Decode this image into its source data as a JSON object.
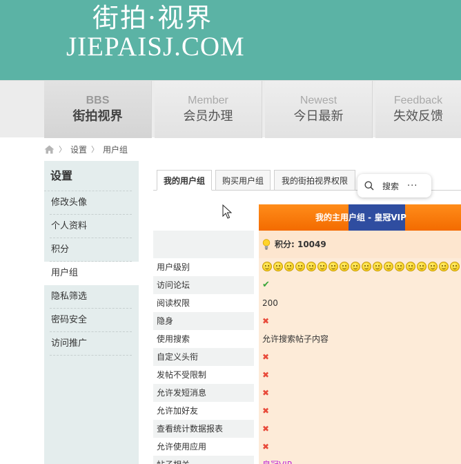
{
  "banner": {
    "logo_cn": "街拍·视界",
    "logo_en": "JIEPAISJ.COM"
  },
  "nav": [
    {
      "en": "BBS",
      "cn": "街拍视界"
    },
    {
      "en": "Member",
      "cn": "会员办理"
    },
    {
      "en": "Newest",
      "cn": "今日最新"
    },
    {
      "en": "Feedback",
      "cn": "失效反馈"
    }
  ],
  "breadcrumb": {
    "items": [
      "设置",
      "用户组"
    ]
  },
  "sidebar": {
    "title": "设置",
    "items": [
      "修改头像",
      "个人资料",
      "积分",
      "用户组",
      "隐私筛选",
      "密码安全",
      "访问推广"
    ]
  },
  "tabs": [
    "我的用户组",
    "购买用户组",
    "我的街拍视界权限"
  ],
  "search": {
    "label": "搜索",
    "more": "···"
  },
  "group": {
    "title": "我的主用户组 - 皇冠VIP",
    "points_label": "积分: 10049",
    "rows": [
      {
        "label": "用户级别",
        "value": ""
      },
      {
        "label": "访问论坛",
        "value": "✔"
      },
      {
        "label": "阅读权限",
        "value": "200"
      },
      {
        "label": "隐身",
        "value": "✖"
      },
      {
        "label": "使用搜索",
        "value": "允许搜索帖子内容"
      },
      {
        "label": "自定义头衔",
        "value": "✖"
      },
      {
        "label": "发帖不受限制",
        "value": "✖"
      },
      {
        "label": "允许发短消息",
        "value": "✖"
      },
      {
        "label": "允许加好友",
        "value": "✖"
      },
      {
        "label": "查看统计数据报表",
        "value": "✖"
      },
      {
        "label": "允许使用应用",
        "value": "✖"
      },
      {
        "label": "帖子相关",
        "value": "皇冠VIP"
      }
    ],
    "level_icon": "smiley-icon",
    "level_icon_count": 18
  },
  "colors": {
    "banner": "#5bb3a5",
    "header_orange": "#f36b00",
    "header_blue": "#2f4da0",
    "value_bg": "#fdebd8"
  }
}
